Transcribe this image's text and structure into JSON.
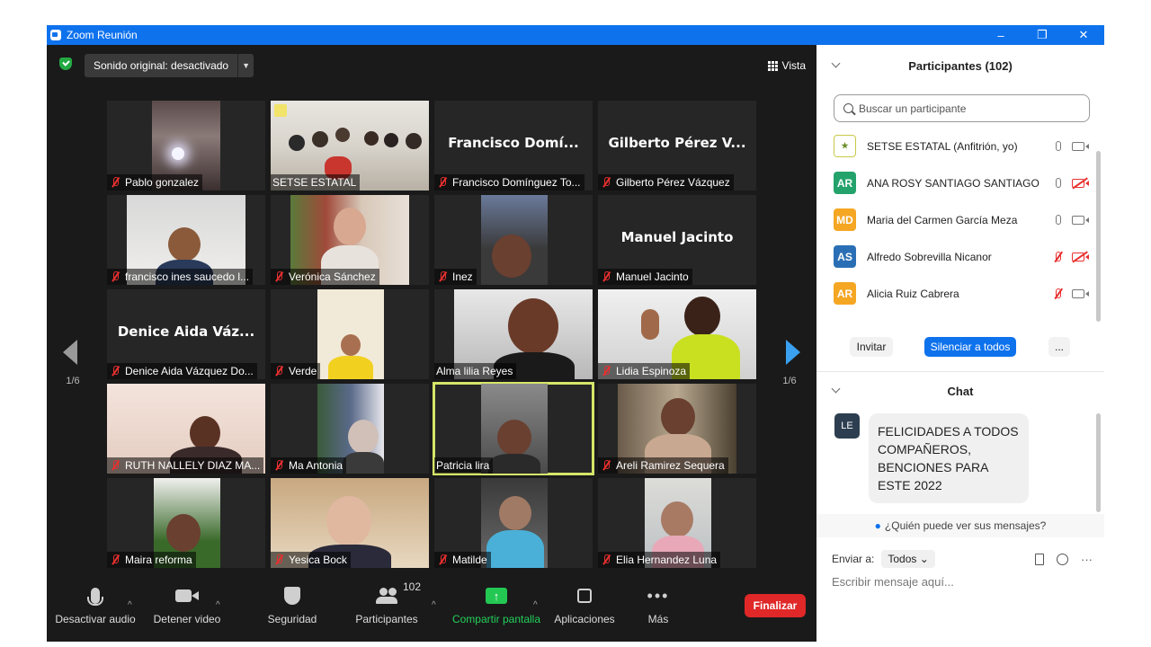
{
  "window": {
    "title": "Zoom Reunión",
    "minimize": "–",
    "restore": "❐",
    "close": "✕"
  },
  "topbar": {
    "audio_label": "Sonido original: desactivado",
    "view_label": "Vista"
  },
  "pagination": {
    "left": "1/6",
    "right": "1/6"
  },
  "tiles": [
    {
      "label": "Pablo gonzalez",
      "big": ""
    },
    {
      "label": "SETSE ESTATAL",
      "big": ""
    },
    {
      "label": "Francisco Domínguez To...",
      "big": "Francisco  Domí..."
    },
    {
      "label": "Gilberto Pérez Vázquez",
      "big": "Gilberto Pérez V..."
    },
    {
      "label": "francisco ines saucedo l...",
      "big": ""
    },
    {
      "label": "Verónica Sánchez",
      "big": ""
    },
    {
      "label": "Inez",
      "big": ""
    },
    {
      "label": "Manuel Jacinto",
      "big": "Manuel Jacinto"
    },
    {
      "label": "Denice Aida Vázquez Do...",
      "big": "Denice  Aida  Váz..."
    },
    {
      "label": "Verde",
      "big": ""
    },
    {
      "label": "Alma lilia Reyes",
      "big": ""
    },
    {
      "label": "Lidia Espinoza",
      "big": ""
    },
    {
      "label": "RUTH NALLELY DIAZ MA...",
      "big": ""
    },
    {
      "label": "Ma Antonia",
      "big": ""
    },
    {
      "label": "Patricia lira",
      "big": ""
    },
    {
      "label": "Areli Ramirez Sequera",
      "big": ""
    },
    {
      "label": "Maira reforma",
      "big": ""
    },
    {
      "label": "Yesica Bock",
      "big": ""
    },
    {
      "label": "Matilde",
      "big": ""
    },
    {
      "label": "Elia Hernandez Luna",
      "big": ""
    }
  ],
  "toolbar": {
    "mute": "Desactivar audio",
    "video": "Detener video",
    "security": "Seguridad",
    "participants": "Participantes",
    "participants_count": "102",
    "share": "Compartir pantalla",
    "apps": "Aplicaciones",
    "more": "Más",
    "end": "Finalizar"
  },
  "participants_panel": {
    "title": "Participantes (102)",
    "search_placeholder": "Buscar un participante",
    "list": [
      {
        "initials": "",
        "name": "SETSE ESTATAL (Anfitrión, yo)",
        "color": "#ffffff",
        "mic_off": false,
        "cam_off": false
      },
      {
        "initials": "AR",
        "name": "ANA ROSY SANTIAGO SANTIAGO",
        "color": "#23a36b",
        "mic_off": false,
        "cam_off": true
      },
      {
        "initials": "MD",
        "name": "Maria del Carmen García Meza",
        "color": "#f5a623",
        "mic_off": false,
        "cam_off": false
      },
      {
        "initials": "AS",
        "name": "Alfredo Sobrevilla Nicanor",
        "color": "#2a6fb5",
        "mic_off": true,
        "cam_off": true
      },
      {
        "initials": "AR",
        "name": "Alicia Ruiz Cabrera",
        "color": "#f5a623",
        "mic_off": true,
        "cam_off": false
      }
    ],
    "invite": "Invitar",
    "mute_all": "Silenciar a todos",
    "more": "..."
  },
  "chat": {
    "title": "Chat",
    "messages": [
      {
        "initials": "LE",
        "text": "FELICIDADES A TODOS COMPAÑEROS, BENCIONES PARA ESTE 2022"
      }
    ],
    "who_sees": "¿Quién puede ver sus mensajes?",
    "send_to_label": "Enviar a:",
    "send_to_value": "Todos",
    "input_placeholder": "Escribir mensaje aquí...",
    "more": "···"
  }
}
